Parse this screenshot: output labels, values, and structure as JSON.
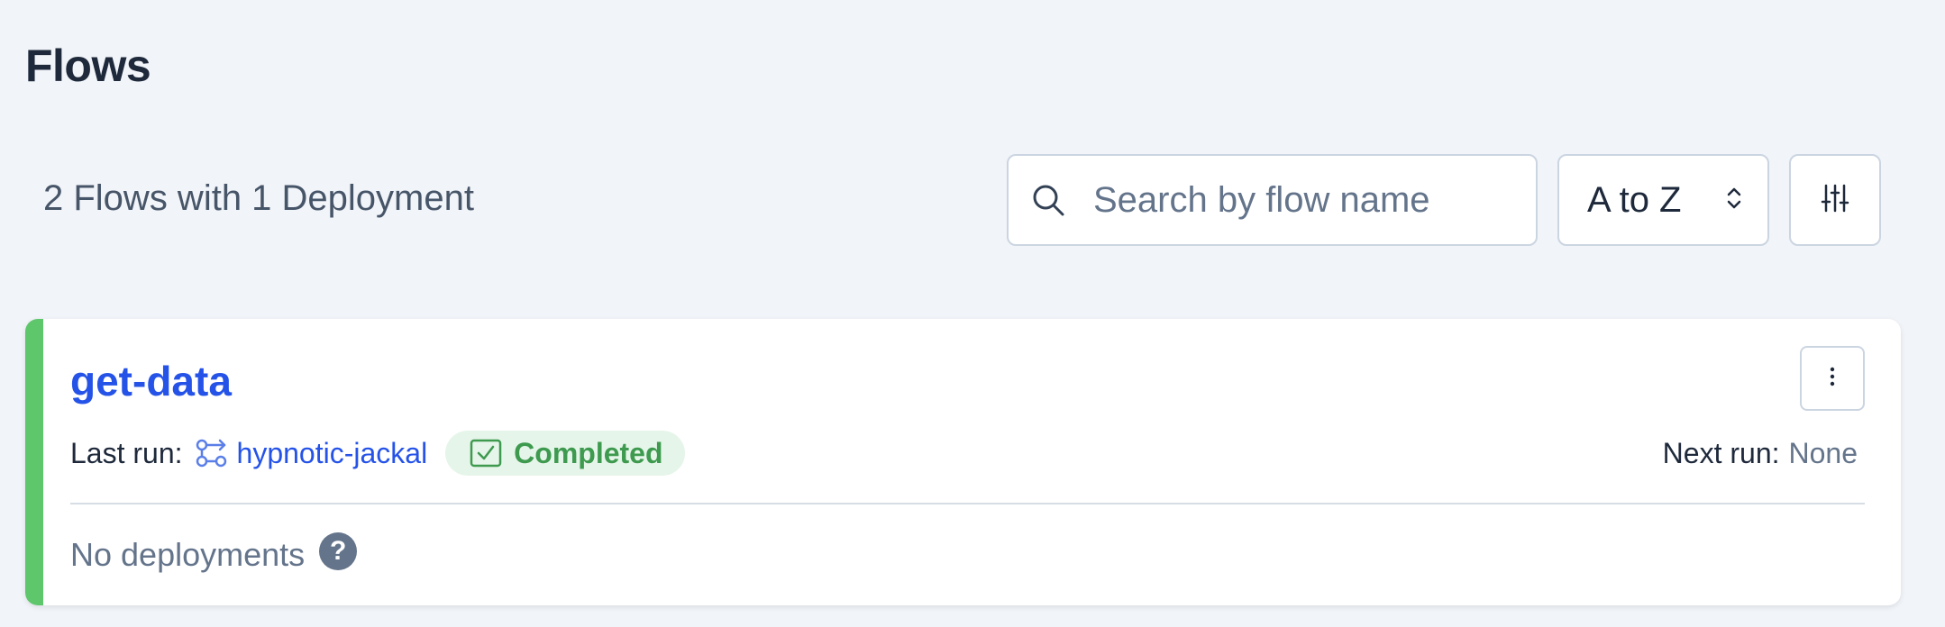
{
  "page": {
    "title": "Flows"
  },
  "toolbar": {
    "summary": "2 Flows with 1 Deployment",
    "search": {
      "placeholder": "Search by flow name",
      "value": "",
      "icon": "search-icon"
    },
    "sort": {
      "selected": "A to Z",
      "icon": "chevron-up-down-icon"
    },
    "filter": {
      "icon": "sliders-icon"
    }
  },
  "flows": [
    {
      "name": "get-data",
      "state_color": "#5ec66b",
      "last_run_label": "Last run:",
      "last_run_icon": "flow-run-icon",
      "last_run_name": "hypnotic-jackal",
      "state": {
        "label": "Completed",
        "icon": "check-square-icon",
        "color": "#3e9a4f",
        "background": "#e6f5ea"
      },
      "next_run_label": "Next run:",
      "next_run_value": "None",
      "deployments_text": "No deployments",
      "help_icon": "question-icon",
      "help_glyph": "?",
      "menu_icon": "kebab-menu-icon"
    }
  ],
  "colors": {
    "accent": "#2553e8",
    "background": "#f1f4f8",
    "text_muted": "#64748b"
  }
}
